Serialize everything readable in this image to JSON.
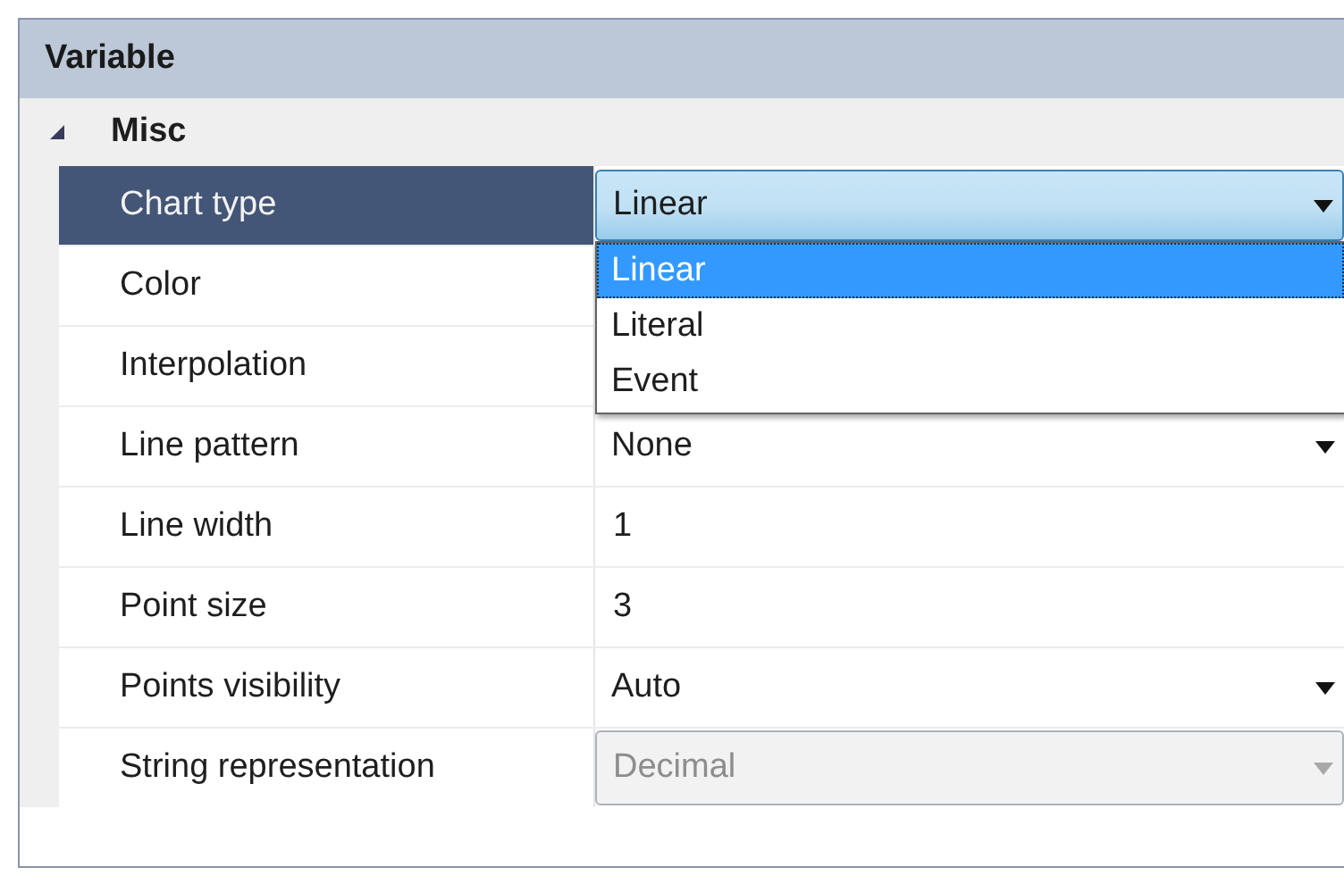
{
  "panel": {
    "title": "Variable"
  },
  "category": {
    "label": "Misc",
    "expanded": true
  },
  "properties": [
    {
      "name": "Chart type",
      "kind": "dropdown",
      "selected": true,
      "disabled": false,
      "value": "Linear",
      "expanded": true,
      "options": [
        {
          "label": "Linear",
          "selected": true
        },
        {
          "label": "Literal",
          "selected": false
        },
        {
          "label": "Event",
          "selected": false
        }
      ]
    },
    {
      "name": "Color",
      "kind": "hidden",
      "selected": false
    },
    {
      "name": "Interpolation",
      "kind": "hidden",
      "selected": false
    },
    {
      "name": "Line pattern",
      "kind": "dropdown",
      "selected": false,
      "disabled": false,
      "value": "None"
    },
    {
      "name": "Line width",
      "kind": "text",
      "selected": false,
      "value": "1"
    },
    {
      "name": "Point size",
      "kind": "text",
      "selected": false,
      "value": "3"
    },
    {
      "name": "Points visibility",
      "kind": "dropdown",
      "selected": false,
      "disabled": false,
      "value": "Auto"
    },
    {
      "name": "String representation",
      "kind": "dropdown",
      "selected": false,
      "disabled": true,
      "value": "Decimal"
    }
  ]
}
